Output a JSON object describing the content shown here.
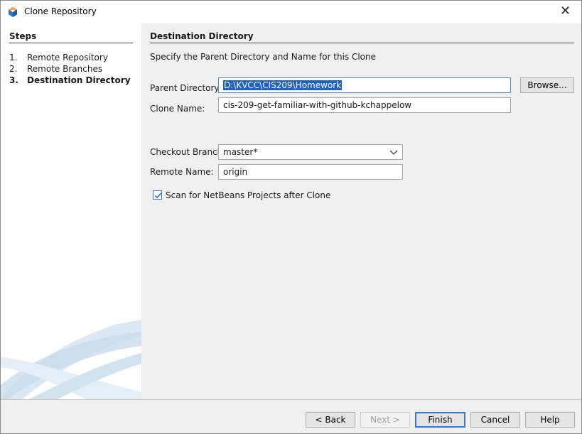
{
  "window": {
    "title": "Clone Repository",
    "close_glyph": "✕",
    "app_icon": "netbeans-cube-icon"
  },
  "steps": {
    "title": "Steps",
    "items": [
      {
        "num": "1.",
        "label": "Remote Repository",
        "active": false
      },
      {
        "num": "2.",
        "label": "Remote Branches",
        "active": false
      },
      {
        "num": "3.",
        "label": "Destination Directory",
        "active": true
      }
    ]
  },
  "main": {
    "title": "Destination Directory",
    "description": "Specify the Parent Directory and Name for this Clone",
    "parent_directory": {
      "label": "Parent Directory:",
      "value": "D:\\KVCC\\CIS209\\Homework"
    },
    "browse_label": "Browse...",
    "clone_name": {
      "label": "Clone Name:",
      "value": "cis-209-get-familiar-with-github-kchappelow"
    },
    "checkout_branch": {
      "label": "Checkout Branch:",
      "value": "master*"
    },
    "remote_name": {
      "label": "Remote Name:",
      "value": "origin"
    },
    "scan_checkbox": {
      "label": "Scan for NetBeans Projects after Clone",
      "checked": true
    }
  },
  "buttons": {
    "back": "< Back",
    "next": "Next >",
    "finish": "Finish",
    "cancel": "Cancel",
    "help": "Help"
  },
  "colors": {
    "selection": "#1e5fcf",
    "focus_border": "#3b78d8",
    "swoosh": "#c9dcec"
  }
}
